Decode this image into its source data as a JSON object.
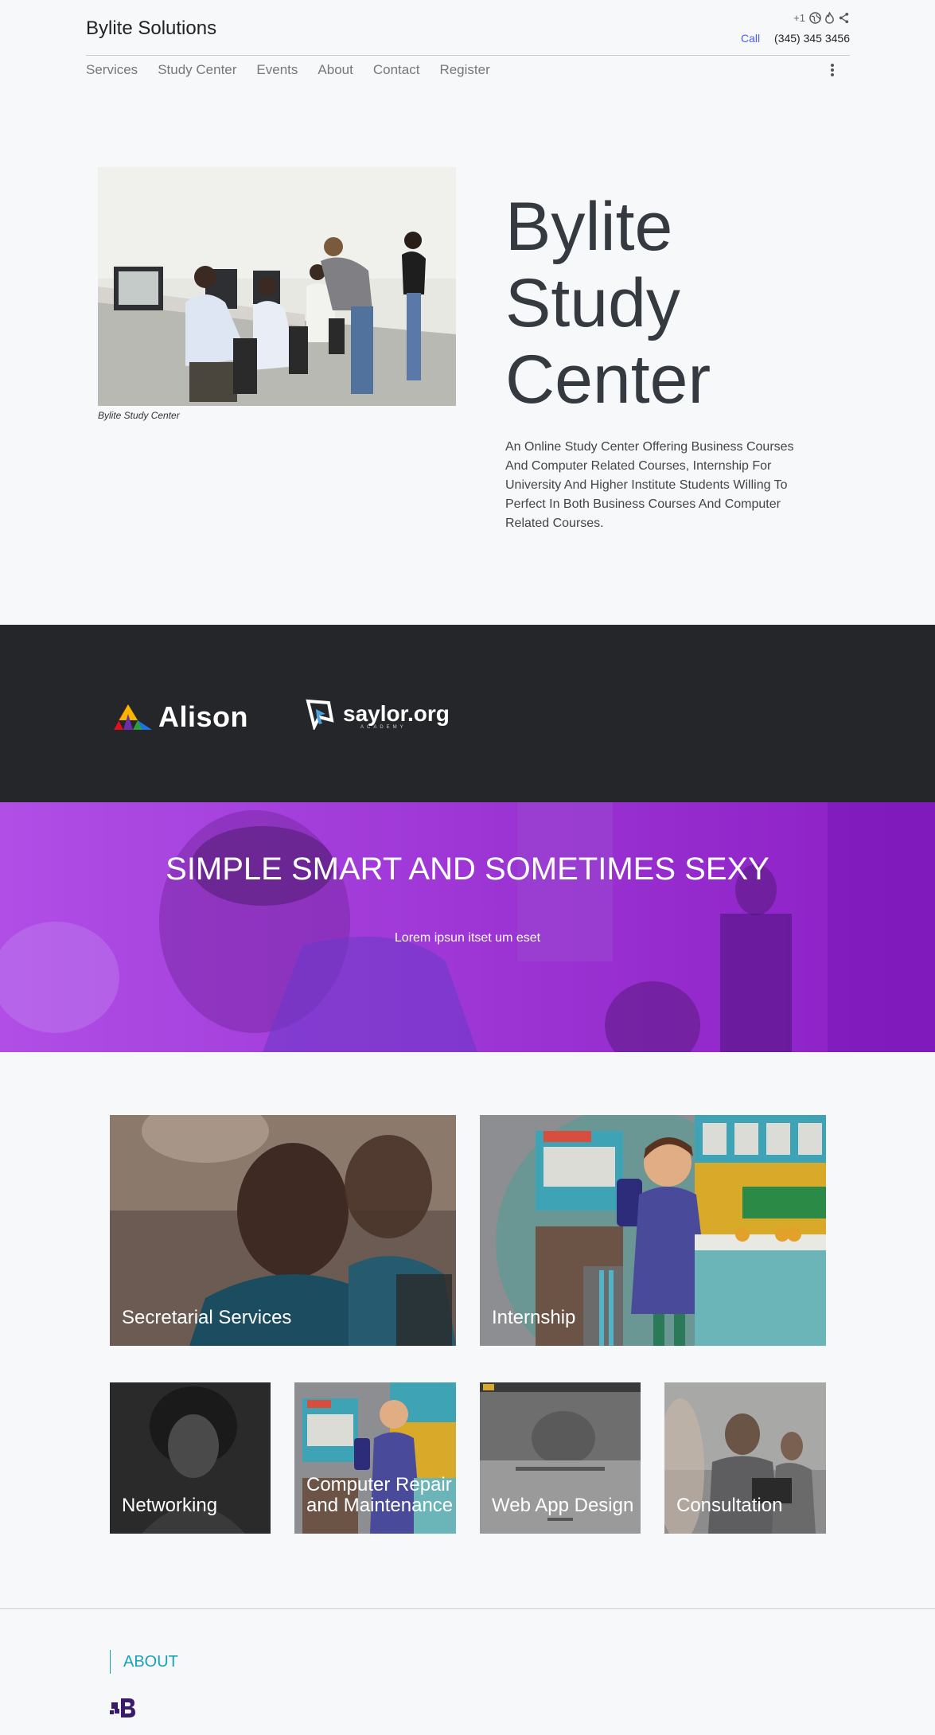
{
  "header": {
    "brand": "Bylite Solutions",
    "phone_prefix": "+1",
    "call_label": "Call",
    "phone_number": "(345) 345 3456",
    "icons": [
      "globe-icon",
      "fire-icon",
      "share-icon"
    ]
  },
  "nav": {
    "items": [
      "Services",
      "Study Center",
      "Events",
      "About",
      "Contact",
      "Register"
    ]
  },
  "hero": {
    "image_caption": "Bylite Study Center",
    "title": "Bylite Study Center",
    "description": "An Online Study Center Offering Business Courses And Computer Related Courses, Internship For University And Higher Institute Students Willing To Perfect In Both Business Courses And Computer Related Courses."
  },
  "partners": {
    "alison": "Alison",
    "saylor": "saylor.org",
    "saylor_sub": "ACADEMY"
  },
  "banner": {
    "title": "SIMPLE SMART AND SOMETIMES SEXY",
    "subtitle": "Lorem ipsun itset um eset"
  },
  "services": {
    "big": [
      "Secretarial Services",
      "Internship"
    ],
    "small": [
      "Networking",
      "Computer Repair and Maintenance",
      "Web App Design",
      "Consultation"
    ]
  },
  "footer": {
    "about": "ABOUT"
  },
  "colors": {
    "accent": "#17a2b8",
    "banner": "#a033d8",
    "dark": "#24262a",
    "link": "#4a5cff"
  }
}
